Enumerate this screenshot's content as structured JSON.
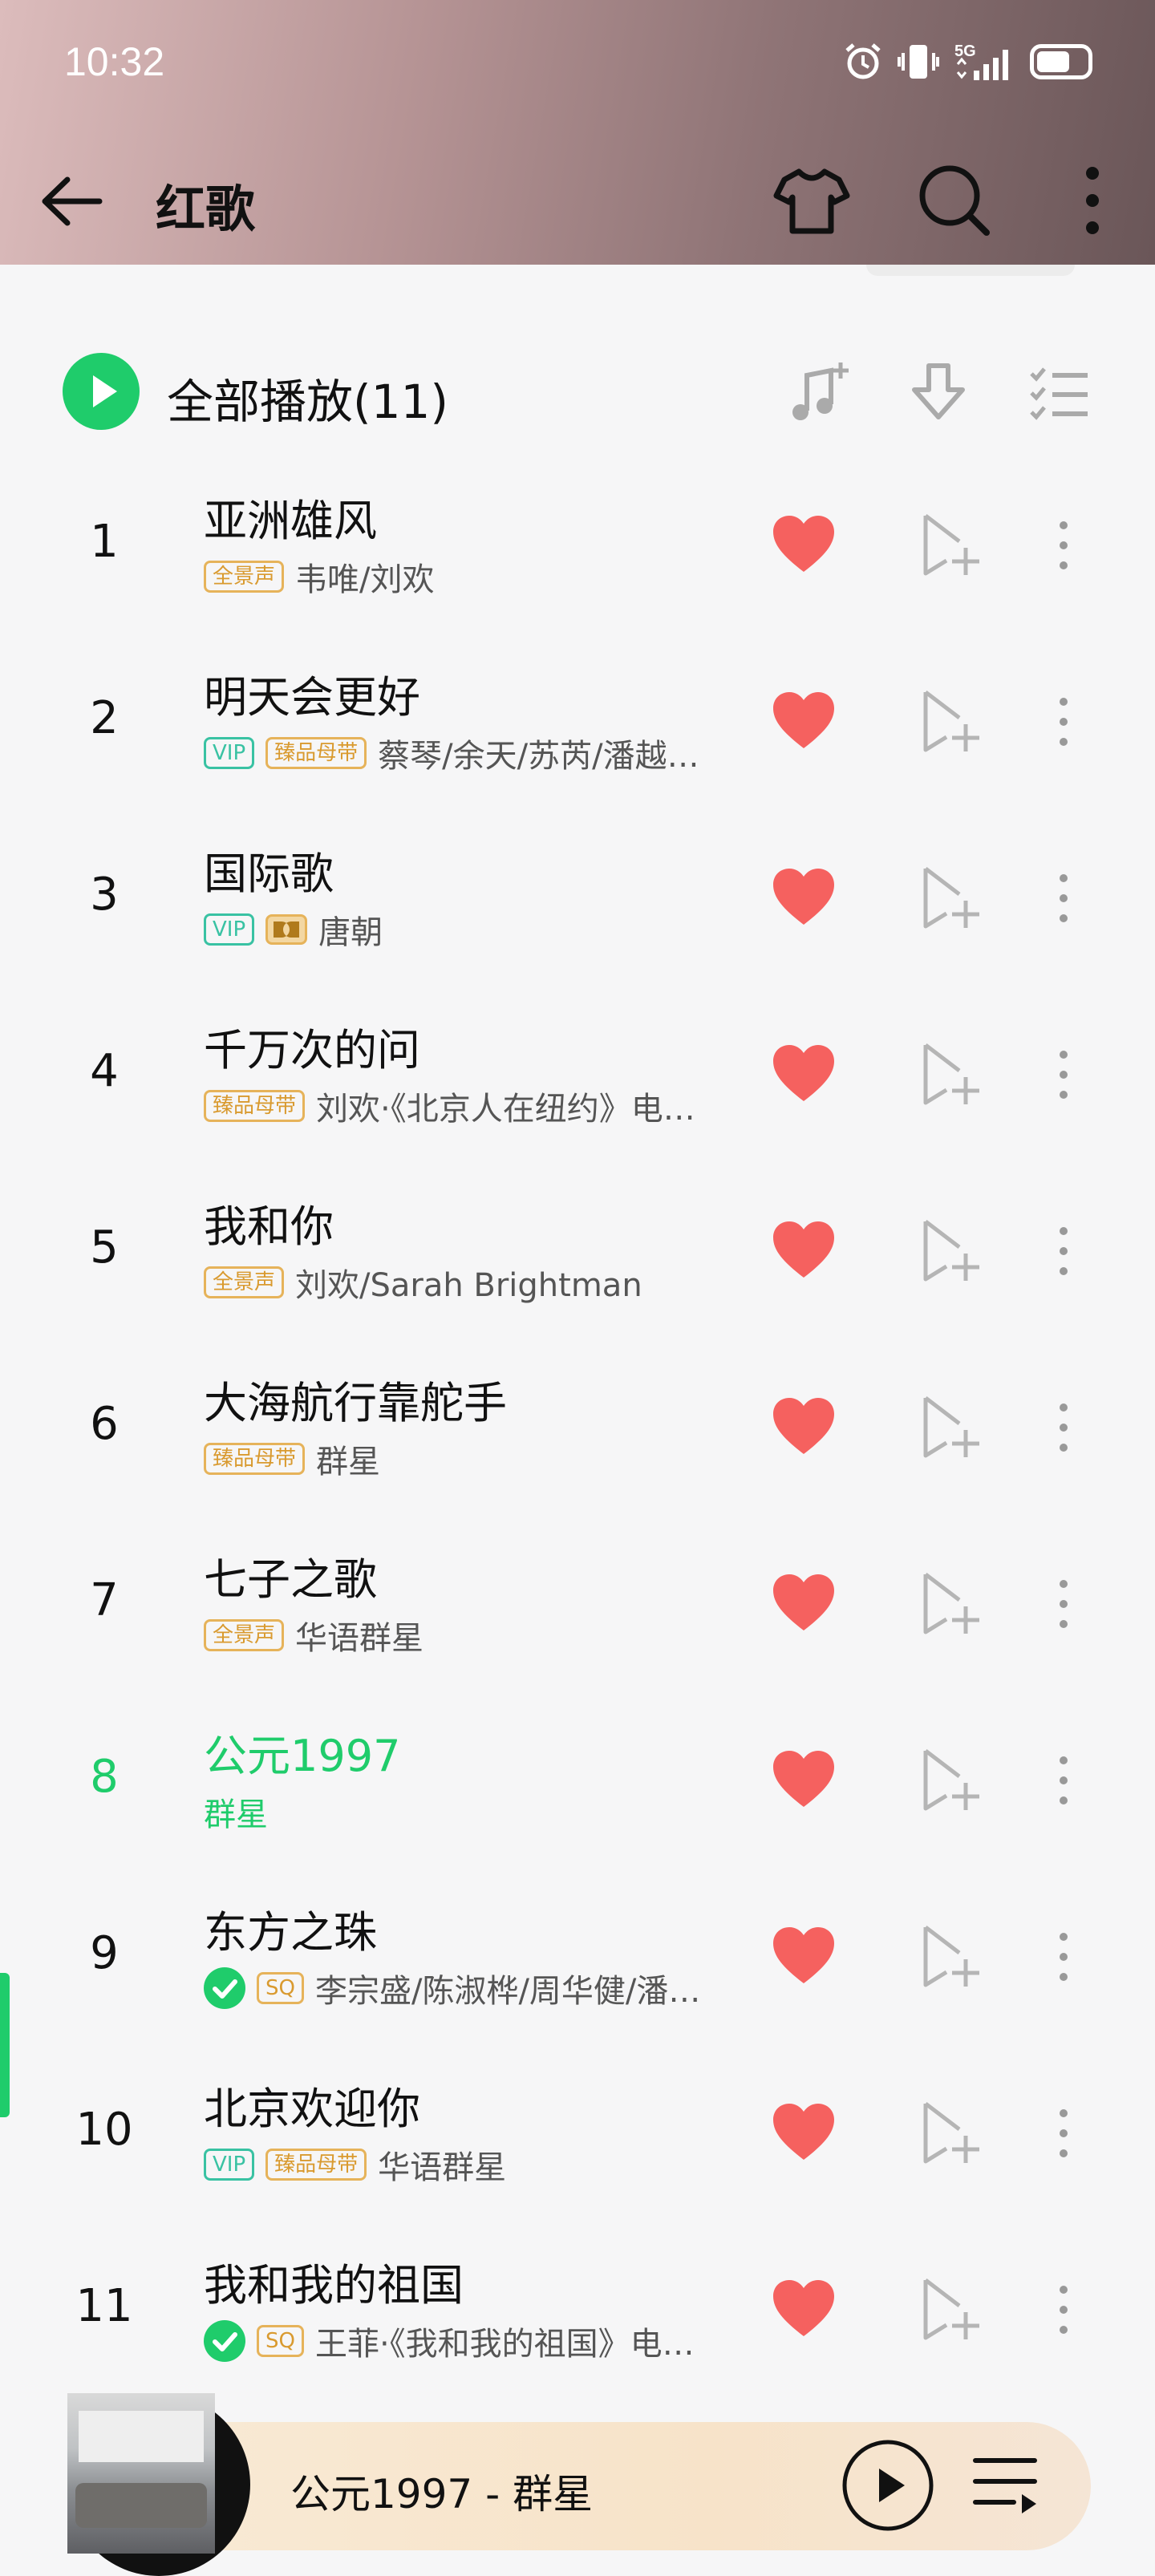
{
  "status_bar": {
    "time": "10:32",
    "network": "5G"
  },
  "toolbar": {
    "title": "红歌"
  },
  "play_all": {
    "label": "全部播放(11)"
  },
  "songs": [
    {
      "num": "1",
      "title": "亚洲雄风",
      "badges": [
        {
          "text": "全景声",
          "kind": "gold"
        }
      ],
      "artist": "韦唯/刘欢"
    },
    {
      "num": "2",
      "title": "明天会更好",
      "badges": [
        {
          "text": "VIP",
          "kind": "vip"
        },
        {
          "text": "臻品母带",
          "kind": "gold"
        }
      ],
      "artist": "蔡琴/余天/苏芮/潘越…"
    },
    {
      "num": "3",
      "title": "国际歌",
      "badges": [
        {
          "text": "VIP",
          "kind": "vip"
        },
        {
          "text": "",
          "kind": "dolby"
        }
      ],
      "artist": "唐朝"
    },
    {
      "num": "4",
      "title": "千万次的问",
      "badges": [
        {
          "text": "臻品母带",
          "kind": "gold"
        }
      ],
      "artist": "刘欢·《北京人在纽约》电…"
    },
    {
      "num": "5",
      "title": "我和你",
      "badges": [
        {
          "text": "全景声",
          "kind": "gold"
        }
      ],
      "artist": "刘欢/Sarah Brightman"
    },
    {
      "num": "6",
      "title": "大海航行靠舵手",
      "badges": [
        {
          "text": "臻品母带",
          "kind": "gold"
        }
      ],
      "artist": "群星"
    },
    {
      "num": "7",
      "title": "七子之歌",
      "badges": [
        {
          "text": "全景声",
          "kind": "gold"
        }
      ],
      "artist": "华语群星"
    },
    {
      "num": "8",
      "title": "公元1997",
      "badges": [],
      "artist": "群星",
      "active": true
    },
    {
      "num": "9",
      "title": "东方之珠",
      "badges": [
        {
          "text": "",
          "kind": "check"
        },
        {
          "text": "SQ",
          "kind": "gold"
        }
      ],
      "artist": "李宗盛/陈淑桦/周华健/潘…"
    },
    {
      "num": "10",
      "title": "北京欢迎你",
      "badges": [
        {
          "text": "VIP",
          "kind": "vip"
        },
        {
          "text": "臻品母带",
          "kind": "gold"
        }
      ],
      "artist": "华语群星"
    },
    {
      "num": "11",
      "title": "我和我的祖国",
      "badges": [
        {
          "text": "",
          "kind": "check"
        },
        {
          "text": "SQ",
          "kind": "gold"
        }
      ],
      "artist": "王菲·《我和我的祖国》电…"
    }
  ],
  "mini_player": {
    "now_playing": "公元1997 - 群星"
  },
  "colors": {
    "accent": "#1fcc6b",
    "heart": "#f5615f",
    "gold_badge": "#e6b35a",
    "vip_badge": "#39c2a3"
  }
}
